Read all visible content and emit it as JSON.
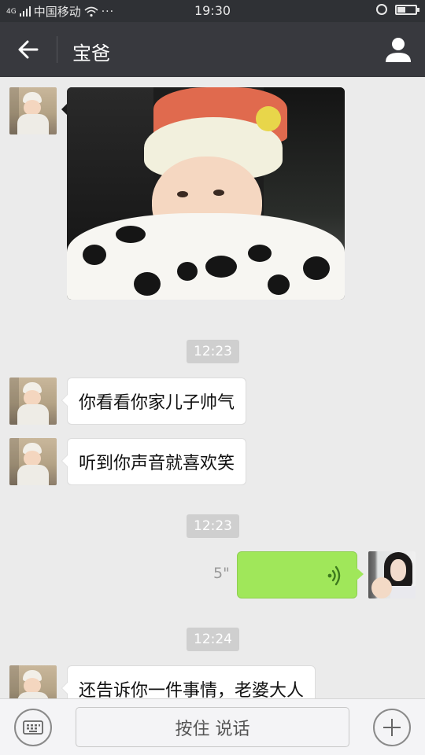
{
  "status_bar": {
    "carrier": "中国移动",
    "network": "4G",
    "more": "···",
    "time": "19:30",
    "icons": [
      "signal-icon",
      "wifi-icon",
      "alarm-icon",
      "battery-icon"
    ]
  },
  "header": {
    "title": "宝爸",
    "back_icon": "arrow-left-icon",
    "profile_icon": "person-icon"
  },
  "messages": [
    {
      "type": "image",
      "side": "left",
      "sender": "宝爸",
      "description_icon": "photo-baby"
    },
    {
      "type": "timestamp",
      "text": "12:23"
    },
    {
      "type": "text",
      "side": "left",
      "text": "你看看你家儿子帅气"
    },
    {
      "type": "text",
      "side": "left",
      "text": "听到你声音就喜欢笑"
    },
    {
      "type": "timestamp",
      "text": "12:23"
    },
    {
      "type": "voice",
      "side": "right",
      "duration": "5\""
    },
    {
      "type": "timestamp",
      "text": "12:24"
    },
    {
      "type": "text",
      "side": "left",
      "text": "还告诉你一件事情，老婆大人"
    }
  ],
  "input_bar": {
    "talk_label": "按住 说话",
    "keyboard_icon": "keyboard-icon",
    "plus_icon": "plus-icon"
  },
  "colors": {
    "title_bar": "#38393e",
    "status_bar": "#2f3135",
    "chat_bg": "#ebebeb",
    "voice_bubble": "#a0e75a",
    "timestamp_bg": "#cfcfcf"
  }
}
